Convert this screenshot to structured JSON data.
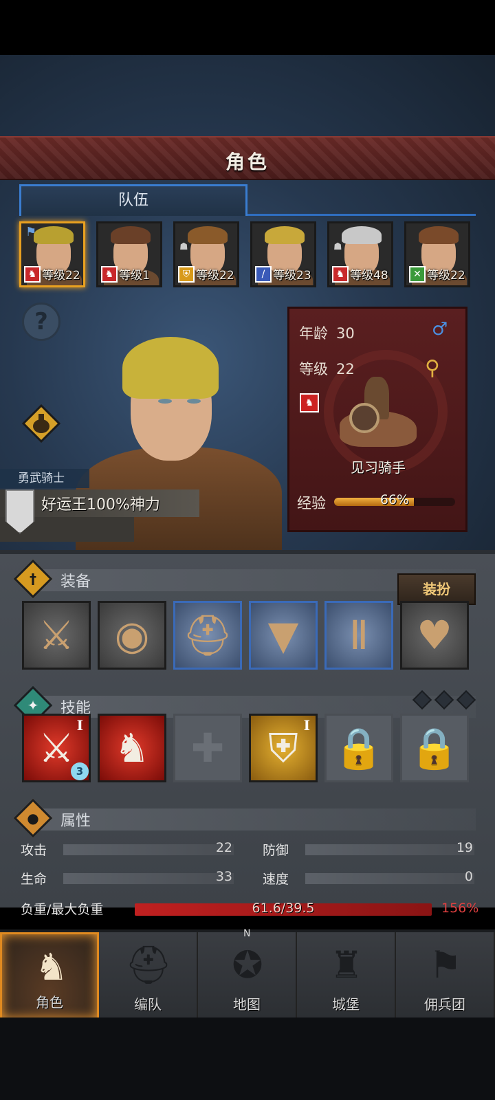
{
  "header": {
    "title": "角色"
  },
  "tabs": [
    {
      "label": "队伍",
      "active": true
    }
  ],
  "party": [
    {
      "level_text": "等级22",
      "role_icon": "horse-icon",
      "role_color": "#c8282a",
      "hair": "#b8a030",
      "selected": true,
      "leader_flag": true
    },
    {
      "level_text": "等级1",
      "role_icon": "horse-icon",
      "role_color": "#c8282a",
      "hair": "#6a4028",
      "selected": false
    },
    {
      "level_text": "等级22",
      "role_icon": "shield-icon",
      "role_color": "#d89a1a",
      "hair": "#8a5a2a",
      "selected": false,
      "ally": true
    },
    {
      "level_text": "等级23",
      "role_icon": "sword-icon",
      "role_color": "#3a5ab8",
      "hair": "#c8a83a",
      "selected": false
    },
    {
      "level_text": "等级48",
      "role_icon": "horse-icon",
      "role_color": "#c8282a",
      "hair": "#c8c8c8",
      "selected": false,
      "ally": true
    },
    {
      "level_text": "等级22",
      "role_icon": "crossed-swords-icon",
      "role_color": "#3a9a3a",
      "hair": "#7a4a2a",
      "selected": false
    }
  ],
  "hero": {
    "class_title": "勇武骑士",
    "trait": "好运王100%神力",
    "age_label": "年龄",
    "age": "30",
    "level_label": "等级",
    "level": "22",
    "unit_name": "见习骑手",
    "exp_label": "经验",
    "exp_percent_text": "66%",
    "exp_fraction": 0.66
  },
  "equipment": {
    "title": "装备",
    "dress_button": "装扮",
    "slots": [
      {
        "name": "crossbow-icon",
        "glyph": "⚔",
        "highlight": false
      },
      {
        "name": "round-shield-icon",
        "glyph": "◉",
        "highlight": false
      },
      {
        "name": "helmet-icon",
        "glyph": "⛑",
        "highlight": true
      },
      {
        "name": "leather-armor-icon",
        "glyph": "▼",
        "highlight": true
      },
      {
        "name": "leather-boots-icon",
        "glyph": "Ⅱ",
        "highlight": true
      },
      {
        "name": "heart-amulet-icon",
        "glyph": "♥",
        "highlight": false
      }
    ]
  },
  "skills": {
    "title": "技能",
    "slots": [
      {
        "name": "sword-strike-skill-icon",
        "rank": "I",
        "badge": "3",
        "kind": "red",
        "glyph": "⚔"
      },
      {
        "name": "horse-charge-skill-icon",
        "kind": "red",
        "glyph": "♞"
      },
      {
        "name": "empty-skill-slot-cross-icon",
        "kind": "empty",
        "glyph": "✚"
      },
      {
        "name": "shield-skill-icon",
        "rank": "I",
        "kind": "yellow",
        "glyph": "⛨"
      },
      {
        "name": "locked-slot-icon",
        "kind": "empty",
        "glyph": "🔒"
      },
      {
        "name": "locked-slot-icon",
        "kind": "empty",
        "glyph": "🔒"
      }
    ]
  },
  "attributes": {
    "title": "属性",
    "attack_label": "攻击",
    "attack": "22",
    "defense_label": "防御",
    "defense": "19",
    "hp_label": "生命",
    "hp": "33",
    "speed_label": "速度",
    "speed": "0",
    "weight_label": "负重/最大负重",
    "weight_value": "61.6/39.5",
    "weight_percent": "156%"
  },
  "nav": [
    {
      "label": "角色",
      "icon": "knight-icon",
      "active": true
    },
    {
      "label": "编队",
      "icon": "formation-helmet-icon",
      "active": false
    },
    {
      "label": "地图",
      "icon": "compass-map-icon",
      "active": false
    },
    {
      "label": "城堡",
      "icon": "castle-icon",
      "active": false
    },
    {
      "label": "佣兵团",
      "icon": "mercenary-banner-icon",
      "active": false
    }
  ],
  "compass_letter": "N"
}
